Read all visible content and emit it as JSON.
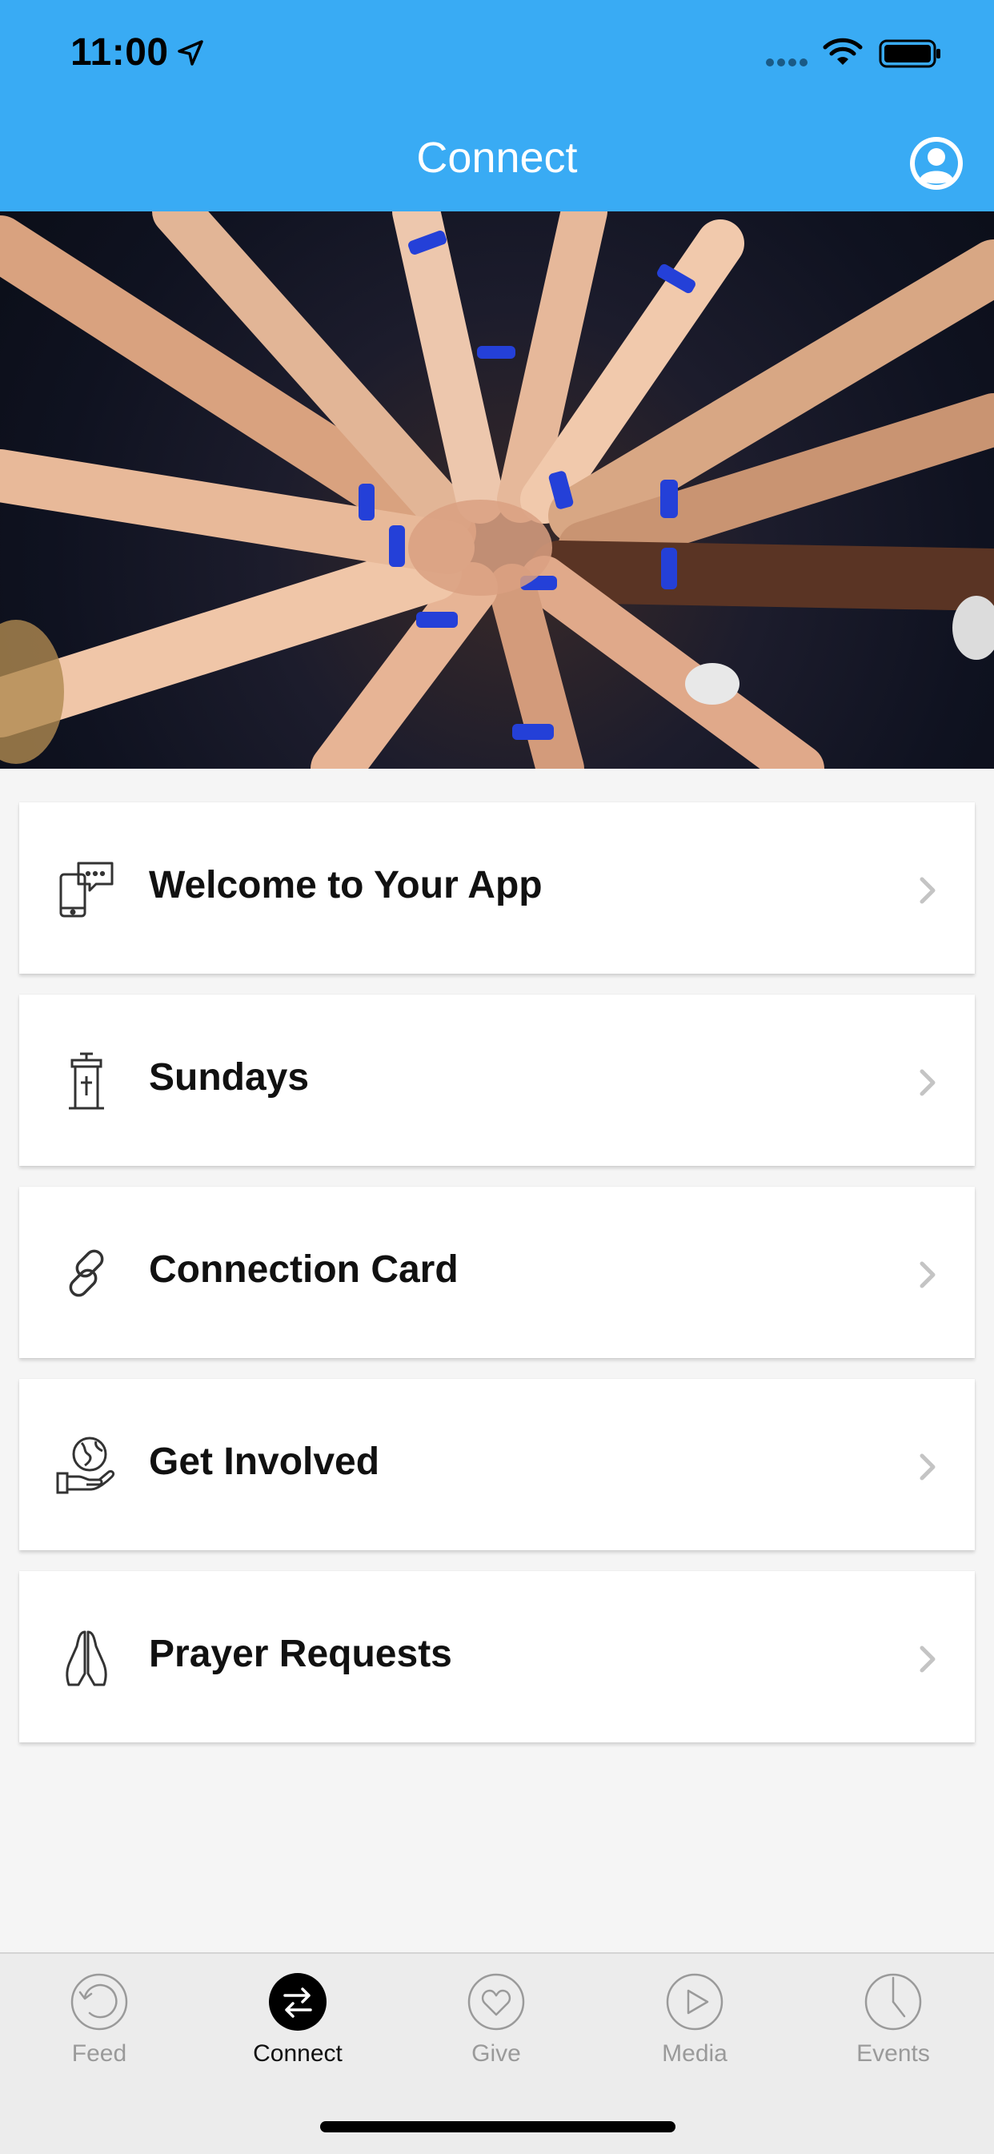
{
  "status_bar": {
    "time": "11:00"
  },
  "header": {
    "title": "Connect",
    "icons": [
      "location-arrow-icon",
      "signal-icon",
      "wifi-icon",
      "battery-icon",
      "profile-icon"
    ]
  },
  "hero": {
    "description_icon": "hands-together-photo"
  },
  "menu": {
    "items": [
      {
        "label": "Welcome to Your App",
        "icon": "phone-chat-icon"
      },
      {
        "label": "Sundays",
        "icon": "pulpit-icon"
      },
      {
        "label": "Connection Card",
        "icon": "link-icon"
      },
      {
        "label": "Get Involved",
        "icon": "globe-hand-icon"
      },
      {
        "label": "Prayer Requests",
        "icon": "praying-hands-icon"
      }
    ]
  },
  "tabbar": {
    "tabs": [
      {
        "label": "Feed",
        "icon": "feed-icon",
        "active": false
      },
      {
        "label": "Connect",
        "icon": "connect-icon",
        "active": true
      },
      {
        "label": "Give",
        "icon": "heart-icon",
        "active": false
      },
      {
        "label": "Media",
        "icon": "play-icon",
        "active": false
      },
      {
        "label": "Events",
        "icon": "clock-icon",
        "active": false
      }
    ]
  },
  "colors": {
    "header": "#39abf4",
    "background": "#f5f5f5",
    "tabbar": "#ececec"
  }
}
